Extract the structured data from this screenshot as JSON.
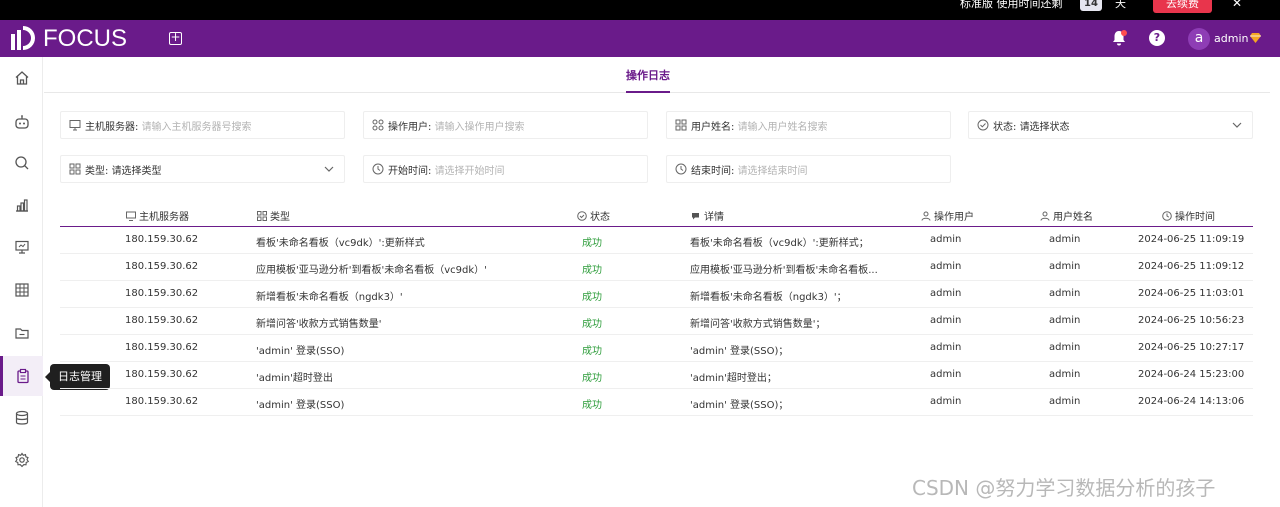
{
  "trial": {
    "edition": "标准版",
    "remaining_label": "使用时间还剩",
    "days": "14",
    "days_unit": "天",
    "buy_label": "去续费",
    "close_glyph": "✕"
  },
  "header": {
    "brand": "FOCUS",
    "add_tab_glyph": "+",
    "help_glyph": "?",
    "avatar_letter": "a",
    "username": "admin",
    "brand_color": "#6a1b8a"
  },
  "sidebar": {
    "items": [
      {
        "icon": "home-icon"
      },
      {
        "icon": "robot-icon"
      },
      {
        "icon": "search-icon"
      },
      {
        "icon": "chart-icon"
      },
      {
        "icon": "presentation-icon"
      },
      {
        "icon": "grid-icon"
      },
      {
        "icon": "folder-icon"
      },
      {
        "icon": "clipboard-icon",
        "active": true,
        "tooltip": "日志管理"
      },
      {
        "icon": "database-icon"
      },
      {
        "icon": "settings-icon"
      }
    ],
    "tooltip": "日志管理"
  },
  "page": {
    "tab": "操作日志"
  },
  "filters": {
    "host": {
      "label": "主机服务器:",
      "placeholder": "请输入主机服务器号搜索"
    },
    "operator": {
      "label": "操作用户:",
      "placeholder": "请输入操作用户搜索"
    },
    "username": {
      "label": "用户姓名:",
      "placeholder": "请输入用户姓名搜索"
    },
    "status": {
      "label": "状态:",
      "value": "请选择状态"
    },
    "type": {
      "label": "类型:",
      "value": "请选择类型"
    },
    "start": {
      "label": "开始时间:",
      "placeholder": "请选择开始时间"
    },
    "end": {
      "label": "结束时间:",
      "placeholder": "请选择结束时间"
    }
  },
  "table": {
    "columns": {
      "host": "主机服务器",
      "type": "类型",
      "status": "状态",
      "detail": "详情",
      "operator": "操作用户",
      "username": "用户姓名",
      "time": "操作时间"
    },
    "rows": [
      {
        "host": "180.159.30.62",
        "type": "看板'未命名看板（vc9dk）':更新样式",
        "status": "成功",
        "detail": "看板'未命名看板（vc9dk）':更新样式；",
        "operator": "admin",
        "username": "admin",
        "time": "2024-06-25 11:09:19"
      },
      {
        "host": "180.159.30.62",
        "type": "应用模板'亚马逊分析'到看板'未命名看板（vc9dk）'",
        "status": "成功",
        "detail": "应用模板'亚马逊分析'到看板'未命名看板...",
        "operator": "admin",
        "username": "admin",
        "time": "2024-06-25 11:09:12"
      },
      {
        "host": "180.159.30.62",
        "type": "新增看板'未命名看板（ngdk3）'",
        "status": "成功",
        "detail": "新增看板'未命名看板（ngdk3）'；",
        "operator": "admin",
        "username": "admin",
        "time": "2024-06-25 11:03:01"
      },
      {
        "host": "180.159.30.62",
        "type": "新增问答'收款方式销售数量'",
        "status": "成功",
        "detail": "新增问答'收款方式销售数量'；",
        "operator": "admin",
        "username": "admin",
        "time": "2024-06-25 10:56:23"
      },
      {
        "host": "180.159.30.62",
        "type": "'admin' 登录(SSO)",
        "status": "成功",
        "detail": "'admin' 登录(SSO)；",
        "operator": "admin",
        "username": "admin",
        "time": "2024-06-25 10:27:17"
      },
      {
        "host": "180.159.30.62",
        "type": "'admin'超时登出",
        "status": "成功",
        "detail": "'admin'超时登出；",
        "operator": "admin",
        "username": "admin",
        "time": "2024-06-24 15:23:00"
      },
      {
        "host": "180.159.30.62",
        "type": "'admin' 登录(SSO)",
        "status": "成功",
        "detail": "'admin' 登录(SSO)；",
        "operator": "admin",
        "username": "admin",
        "time": "2024-06-24 14:13:06"
      }
    ]
  },
  "watermark": "CSDN @努力学习数据分析的孩子"
}
